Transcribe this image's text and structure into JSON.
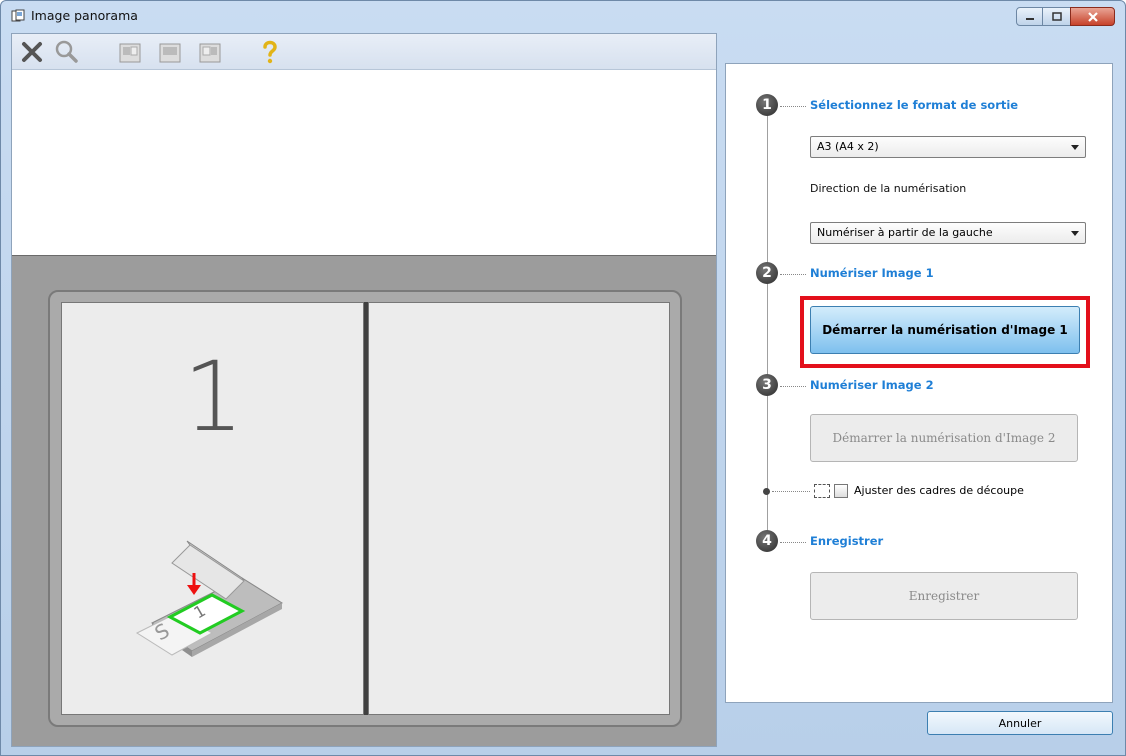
{
  "window": {
    "title": "Image panorama"
  },
  "toolbar": {
    "tools": [
      "delete-icon",
      "zoom-icon",
      "scan-left-icon",
      "scan-both-icon",
      "scan-right-icon",
      "help-icon"
    ]
  },
  "preview": {
    "panel1_number": "1"
  },
  "steps": {
    "step1": {
      "number": "1",
      "label": "Sélectionnez le format de sortie"
    },
    "output_format": {
      "value": "A3 (A4 x 2)"
    },
    "direction_label": "Direction de la numérisation",
    "direction": {
      "value": "Numériser à partir de la gauche"
    },
    "step2": {
      "number": "2",
      "label": "Numériser Image 1",
      "button": "Démarrer la numérisation d'Image 1"
    },
    "step3": {
      "number": "3",
      "label": "Numériser Image 2",
      "button": "Démarrer la numérisation d'Image 2"
    },
    "crop_label": "Ajuster des cadres de découpe",
    "step4": {
      "number": "4",
      "label": "Enregistrer",
      "button": "Enregistrer"
    }
  },
  "footer": {
    "cancel": "Annuler"
  },
  "colors": {
    "accent": "#1f7fd6",
    "highlight": "#e3101b",
    "active_button": "#7ec0ee"
  }
}
